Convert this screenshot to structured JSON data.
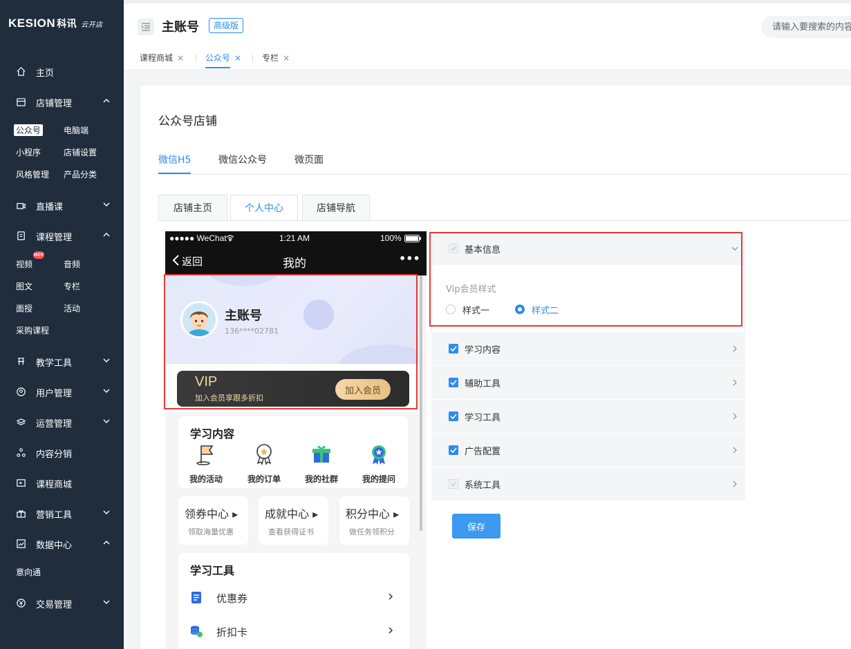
{
  "brand": {
    "name": "KESION",
    "cn": "科讯",
    "tag": "云开店"
  },
  "sidebar": {
    "home": "主页",
    "store": {
      "label": "店铺管理",
      "subs": [
        "公众号",
        "电脑端",
        "小程序",
        "店铺设置",
        "风格管理",
        "产品分类"
      ]
    },
    "live": "直播课",
    "course": {
      "label": "课程管理",
      "subs": [
        "视频",
        "音频",
        "图文",
        "专栏",
        "面授",
        "活动",
        "采购课程"
      ],
      "hot": "HOT"
    },
    "teach": "教学工具",
    "users": "用户管理",
    "ops": "运营管理",
    "distribution": "内容分销",
    "mall": "课程商城",
    "marketing": "营销工具",
    "data": {
      "label": "数据中心",
      "subs": [
        "意向通"
      ]
    },
    "trade": "交易管理"
  },
  "header": {
    "account": "主账号",
    "badge": "高级版",
    "search_placeholder": "请输入要搜索的内容"
  },
  "page_tabs": [
    "课程商城",
    "公众号",
    "专栏"
  ],
  "page_tab_close": "×",
  "panel": {
    "title": "公众号店铺",
    "subtabs": [
      "微信H5",
      "微信公众号",
      "微页面"
    ],
    "boxtabs": [
      "店铺主页",
      "个人中心",
      "店铺导航"
    ]
  },
  "phone": {
    "status": {
      "carrier": "●●●●● WeChat",
      "time": "1:21 AM",
      "battery": "100%"
    },
    "nav": {
      "back": "返回",
      "title": "我的",
      "more": "•••"
    },
    "user": {
      "name": "主账号",
      "phone": "136****02781"
    },
    "vip": {
      "title": "VIP",
      "subtitle": "加入会员享跟多折扣",
      "button": "加入会员"
    },
    "learning": {
      "title": "学习内容",
      "items": [
        "我的活动",
        "我的订单",
        "我的社群",
        "我的提问"
      ]
    },
    "centers": [
      {
        "title": "领券中心 ▸",
        "sub": "领取海量优惠"
      },
      {
        "title": "成就中心 ▸",
        "sub": "查看获得证书"
      },
      {
        "title": "积分中心 ▸",
        "sub": "做任务领积分"
      }
    ],
    "tools": {
      "title": "学习工具",
      "items": [
        "优惠券",
        "折扣卡"
      ]
    }
  },
  "settings": {
    "basic": "基本信息",
    "vip_style_label": "Vip会员样式",
    "styles": [
      "样式一",
      "样式二"
    ],
    "selected_style": "样式二",
    "rows": [
      {
        "label": "学习内容",
        "checked": true
      },
      {
        "label": "辅助工具",
        "checked": true
      },
      {
        "label": "学习工具",
        "checked": true
      },
      {
        "label": "广告配置",
        "checked": true
      },
      {
        "label": "系统工具",
        "checked": false
      }
    ],
    "save": "保存"
  },
  "colors": {
    "accent": "#2d8cf0",
    "sidebar": "#1f2d3d",
    "highlight_border": "#e53935",
    "vip_gold": "#f3d7a2"
  }
}
